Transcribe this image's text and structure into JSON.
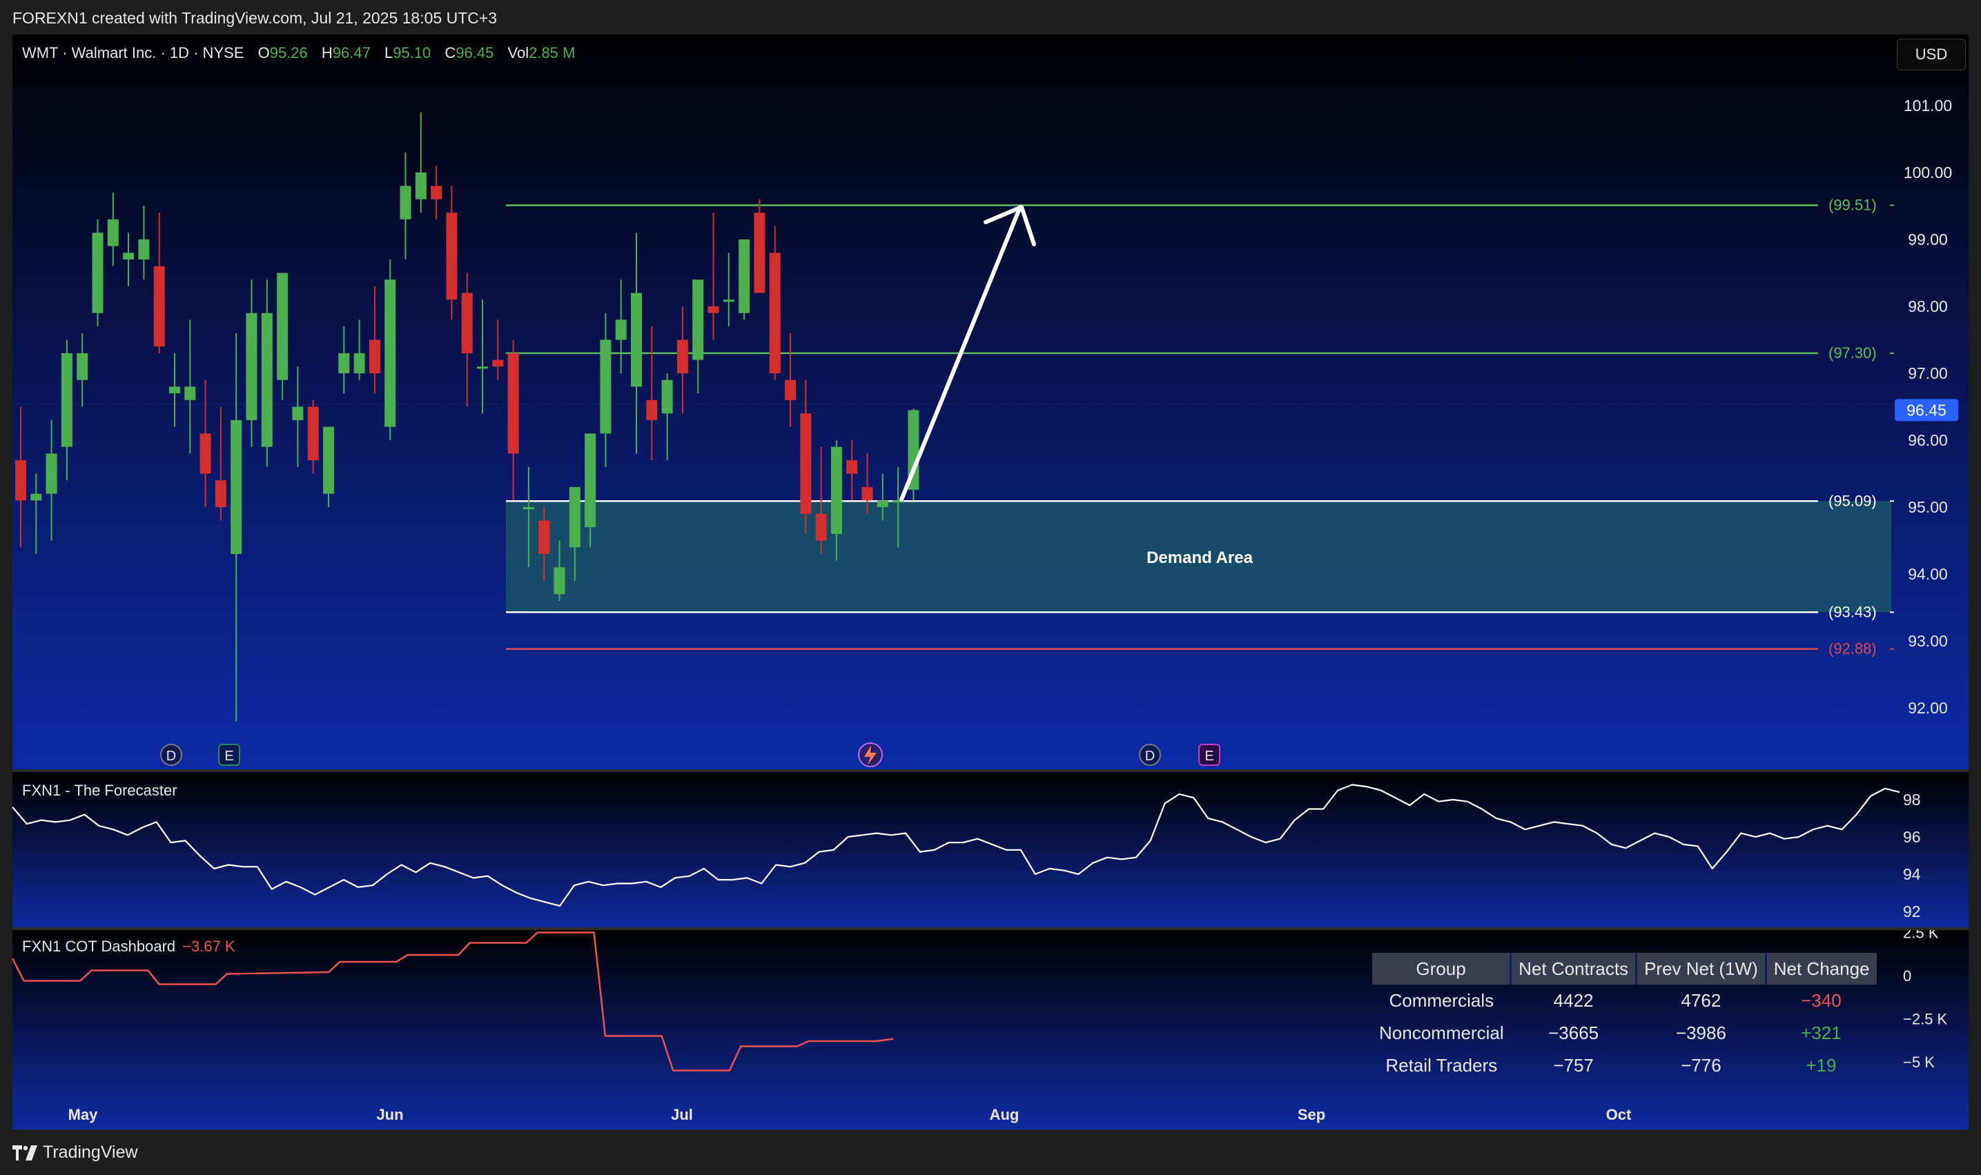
{
  "header": {
    "created_text": "FOREXN1 created with TradingView.com, Jul 21, 2025 18:05 UTC+3"
  },
  "legend": {
    "symbol": "WMT · Walmart Inc. · 1D · NYSE",
    "open_label": "O",
    "open": "95.26",
    "high_label": "H",
    "high": "96.47",
    "low_label": "L",
    "low": "95.10",
    "close_label": "C",
    "close": "96.45",
    "vol_label": "Vol",
    "vol": "2.85 M"
  },
  "currency_button": "USD",
  "price_axis": {
    "ticks": [
      "101.00",
      "100.00",
      "99.00",
      "98.00",
      "97.00",
      "96.00",
      "95.00",
      "94.00",
      "93.00",
      "92.00"
    ],
    "current_price": "96.45"
  },
  "levels": {
    "l1": "(99.51)",
    "l2": "(97.30)",
    "l3": "(95.09)",
    "l4": "(93.43)",
    "l5": "(92.88)"
  },
  "demand_area_label": "Demand Area",
  "event_markers": [
    "D",
    "E",
    "D",
    "E"
  ],
  "forecaster": {
    "title": "FXN1 - The Forecaster",
    "ticks": [
      "98",
      "96",
      "94",
      "92"
    ]
  },
  "cot": {
    "title": "FXN1 COT Dashboard",
    "value": "−3.67 K",
    "ticks": [
      "2.5 K",
      "0",
      "−2.5 K",
      "−5 K"
    ],
    "table": {
      "headers": [
        "Group",
        "Net Contracts",
        "Prev Net (1W)",
        "Net Change"
      ],
      "rows": [
        [
          "Commercials",
          "4422",
          "4762",
          "−340"
        ],
        [
          "Noncommercial",
          "−3665",
          "−3986",
          "+321"
        ],
        [
          "Retail Traders",
          "−757",
          "−776",
          "+19"
        ]
      ]
    }
  },
  "time_axis": [
    "May",
    "Jun",
    "Jul",
    "Aug",
    "Sep",
    "Oct"
  ],
  "footer": {
    "brand": "TradingView"
  },
  "colors": {
    "up": "#4caf50",
    "down": "#d32f2f",
    "level_green": "#5cbf5c",
    "level_red": "#e04850",
    "demand_fill": "#1a5566",
    "current_price_bg": "#2962ff"
  },
  "chart_data": [
    {
      "type": "candlestick",
      "title": "WMT · Walmart Inc. · 1D · NYSE",
      "ylim": [
        91.2,
        101.8
      ],
      "candles": [
        [
          95.7,
          96.5,
          94.4,
          95.1
        ],
        [
          95.1,
          95.5,
          94.3,
          95.2
        ],
        [
          95.2,
          96.3,
          94.5,
          95.8
        ],
        [
          95.9,
          97.5,
          95.4,
          97.3
        ],
        [
          96.9,
          97.6,
          96.5,
          97.3
        ],
        [
          97.9,
          99.3,
          97.7,
          99.1
        ],
        [
          98.9,
          99.7,
          98.6,
          99.3
        ],
        [
          98.7,
          99.1,
          98.3,
          98.8
        ],
        [
          98.7,
          99.5,
          98.4,
          99.0
        ],
        [
          98.6,
          99.4,
          97.3,
          97.4
        ],
        [
          96.7,
          97.3,
          96.2,
          96.8
        ],
        [
          96.6,
          97.8,
          95.8,
          96.8
        ],
        [
          96.1,
          96.9,
          95.0,
          95.5
        ],
        [
          95.4,
          96.5,
          94.8,
          95.0
        ],
        [
          94.3,
          97.6,
          91.8,
          96.3
        ],
        [
          96.3,
          98.4,
          95.9,
          97.9
        ],
        [
          95.9,
          98.4,
          95.6,
          97.9
        ],
        [
          96.9,
          98.5,
          96.6,
          98.5
        ],
        [
          96.3,
          97.1,
          95.6,
          96.5
        ],
        [
          96.5,
          96.6,
          95.5,
          95.7
        ],
        [
          95.2,
          96.2,
          95.0,
          96.2
        ],
        [
          97.0,
          97.7,
          96.7,
          97.3
        ],
        [
          97.0,
          97.8,
          96.9,
          97.3
        ],
        [
          97.5,
          98.3,
          96.7,
          97.0
        ],
        [
          96.2,
          98.7,
          96.0,
          98.4
        ],
        [
          99.3,
          100.3,
          98.7,
          99.8
        ],
        [
          99.6,
          100.9,
          99.4,
          100.0
        ],
        [
          99.8,
          100.1,
          99.3,
          99.6
        ],
        [
          99.4,
          99.8,
          97.8,
          98.1
        ],
        [
          98.2,
          98.5,
          96.5,
          97.3
        ],
        [
          97.1,
          98.1,
          96.4,
          97.1
        ],
        [
          97.2,
          97.8,
          96.9,
          97.1
        ],
        [
          97.3,
          97.5,
          95.1,
          95.8
        ],
        [
          95.0,
          95.6,
          94.1,
          95.0
        ],
        [
          94.8,
          95.0,
          93.9,
          94.3
        ],
        [
          93.7,
          94.5,
          93.6,
          94.1
        ],
        [
          94.4,
          95.2,
          93.9,
          95.3
        ],
        [
          94.7,
          96.1,
          94.4,
          96.1
        ],
        [
          96.1,
          97.9,
          95.6,
          97.5
        ],
        [
          97.5,
          98.4,
          97.0,
          97.8
        ],
        [
          96.8,
          99.1,
          95.8,
          98.2
        ],
        [
          96.6,
          97.7,
          95.7,
          96.3
        ],
        [
          96.4,
          97.0,
          95.7,
          96.9
        ],
        [
          97.5,
          98.0,
          96.4,
          97.0
        ],
        [
          97.2,
          98.3,
          96.7,
          98.4
        ],
        [
          98.0,
          99.4,
          97.5,
          97.9
        ],
        [
          98.1,
          98.8,
          97.7,
          98.1
        ],
        [
          97.9,
          98.6,
          97.8,
          99.0
        ],
        [
          99.4,
          99.6,
          98.3,
          98.2
        ],
        [
          98.8,
          99.2,
          96.9,
          97.0
        ],
        [
          96.9,
          97.6,
          96.2,
          96.6
        ],
        [
          96.4,
          96.9,
          94.6,
          94.9
        ],
        [
          94.9,
          95.9,
          94.3,
          94.5
        ],
        [
          94.6,
          96.0,
          94.2,
          95.9
        ],
        [
          95.7,
          96.0,
          95.1,
          95.5
        ],
        [
          95.3,
          95.8,
          94.9,
          95.1
        ],
        [
          95.0,
          95.5,
          94.8,
          95.1
        ],
        [
          95.1,
          95.6,
          94.4,
          95.1
        ],
        [
          95.26,
          96.47,
          95.1,
          96.45
        ]
      ]
    },
    {
      "type": "line",
      "title": "FXN1 - The Forecaster",
      "ylim": [
        91.2,
        99.0
      ],
      "values": [
        97.6,
        96.7,
        96.9,
        96.8,
        96.9,
        97.2,
        96.6,
        96.4,
        96.1,
        96.5,
        96.8,
        95.7,
        95.8,
        95.0,
        94.3,
        94.5,
        94.4,
        94.4,
        93.2,
        93.6,
        93.3,
        92.9,
        93.3,
        93.7,
        93.3,
        93.4,
        94.0,
        94.5,
        94.1,
        94.6,
        94.4,
        94.1,
        93.8,
        93.9,
        93.4,
        93.0,
        92.7,
        92.5,
        92.3,
        93.4,
        93.6,
        93.4,
        93.5,
        93.5,
        93.6,
        93.3,
        93.8,
        93.9,
        94.3,
        93.7,
        93.7,
        93.8,
        93.5,
        94.5,
        94.4,
        94.6,
        95.2,
        95.3,
        96.0,
        96.1,
        96.2,
        96.1,
        96.2,
        95.2,
        95.3,
        95.7,
        95.7,
        95.9,
        95.6,
        95.3,
        95.3,
        94.0,
        94.3,
        94.2,
        94.0,
        94.6,
        94.9,
        94.8,
        94.9,
        95.8,
        97.8,
        98.3,
        98.1,
        97.0,
        96.8,
        96.4,
        96.0,
        95.7,
        95.9,
        96.9,
        97.5,
        97.5,
        98.5,
        98.8,
        98.7,
        98.5,
        98.1,
        97.7,
        98.3,
        97.9,
        98.0,
        97.9,
        97.5,
        97.0,
        96.8,
        96.4,
        96.6,
        96.8,
        96.7,
        96.6,
        96.2,
        95.6,
        95.4,
        95.8,
        96.2,
        96.0,
        95.6,
        95.5,
        94.3,
        95.2,
        96.2,
        96.0,
        96.2,
        95.9,
        96.0,
        96.4,
        96.6,
        96.4,
        97.2,
        98.2,
        98.6,
        98.4
      ]
    },
    {
      "type": "line",
      "title": "FXN1 COT Dashboard",
      "ylim": [
        -6.0,
        2.8
      ],
      "values": [
        [
          0,
          1.0
        ],
        [
          2,
          -0.3
        ],
        [
          12,
          -0.3
        ],
        [
          14,
          0.3
        ],
        [
          24,
          0.3
        ],
        [
          26,
          -0.5
        ],
        [
          36,
          -0.5
        ],
        [
          38,
          0.1
        ],
        [
          56,
          0.2
        ],
        [
          58,
          0.8
        ],
        [
          68,
          0.8
        ],
        [
          70,
          1.2
        ],
        [
          79,
          1.2
        ],
        [
          81,
          1.9
        ],
        [
          91,
          1.9
        ],
        [
          93,
          2.5
        ],
        [
          103,
          2.5
        ],
        [
          105,
          -3.5
        ],
        [
          115,
          -3.5
        ],
        [
          117,
          -5.5
        ],
        [
          127,
          -5.5
        ],
        [
          129,
          -4.1
        ],
        [
          139,
          -4.1
        ],
        [
          141,
          -3.8
        ],
        [
          153,
          -3.8
        ],
        [
          156,
          -3.67
        ]
      ]
    }
  ]
}
